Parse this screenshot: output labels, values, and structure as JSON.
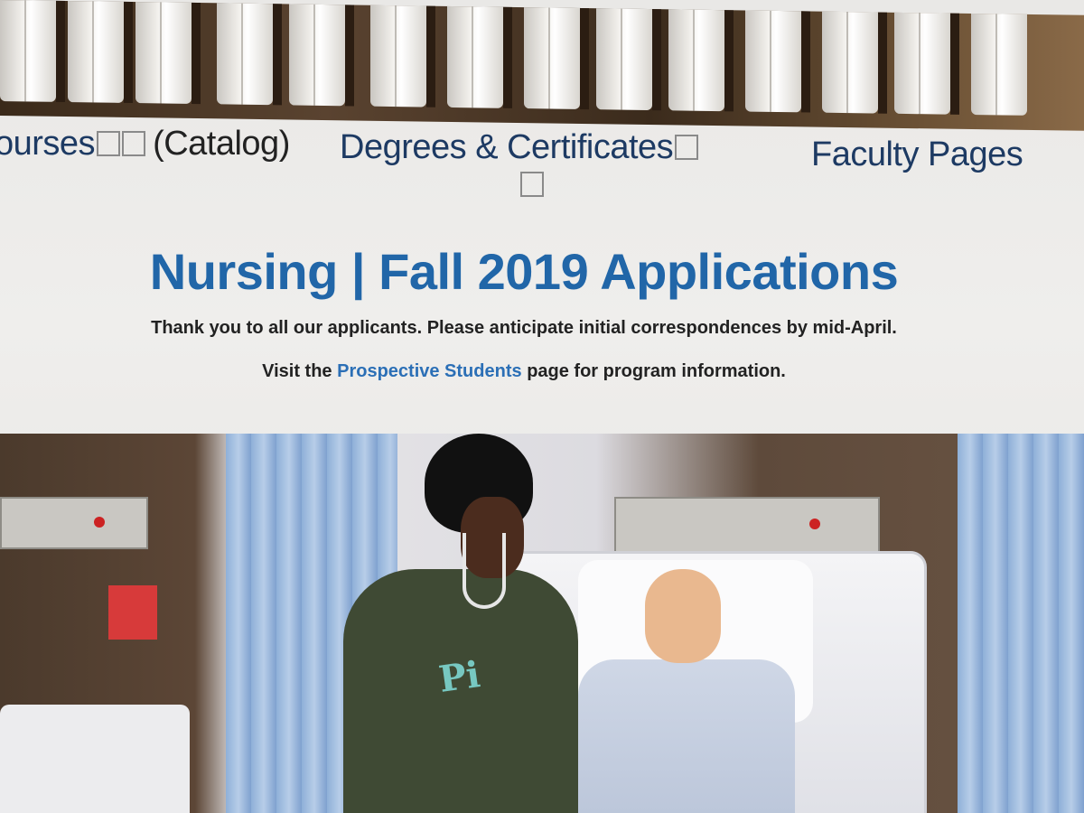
{
  "nav": {
    "courses_label": "ourses",
    "catalog_label": "(Catalog)",
    "degrees_label": "Degrees & Certificates",
    "faculty_label": "Faculty Pages"
  },
  "main": {
    "title": "Nursing | Fall 2019 Applications",
    "thanks_text": "Thank you to all our applicants. Please anticipate initial correspondences by mid-April.",
    "visit_prefix": "Visit the",
    "visit_link": "Prospective Students",
    "visit_suffix": "page for program information."
  },
  "colors": {
    "title_blue": "#2166a8",
    "link_blue": "#2b6fb6",
    "nav_navy": "#1d3a63"
  },
  "icons": {
    "missing_glyph": "box-glyph-icon"
  }
}
